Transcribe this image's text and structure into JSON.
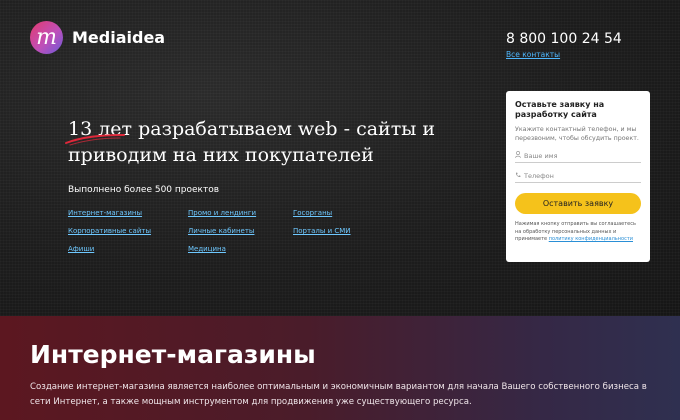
{
  "header": {
    "logo_letter": "m",
    "brand": "Mediaidea",
    "phone": "8 800 100 24 54",
    "contacts_link": "Все контакты"
  },
  "hero": {
    "headline_accent": "13 лет",
    "headline_rest_line1": " разрабатываем web - сайты и",
    "headline_line2": "приводим на них покупателей",
    "projects_count": "Выполнено более 500 проектов",
    "categories": [
      "Интернет-магазины",
      "Промо и лендинги",
      "Госорганы",
      "Корпоративные сайты",
      "Личные кабинеты",
      "Порталы и СМИ",
      "Афиши",
      "Медицина"
    ]
  },
  "form": {
    "title": "Оставьте заявку на разработку сайта",
    "description": "Укажите контактный телефон, и мы перезвоним, чтобы обсудить проект.",
    "name_placeholder": "Ваше имя",
    "phone_placeholder": "Телефон",
    "submit_label": "Оставить заявку",
    "legal_text": "Нажимая кнопку отправить вы соглашаетесь на обработку персональных данных и принимаете",
    "legal_link": "политику конфиденциальности",
    "icons": [
      "user-icon",
      "phone-icon"
    ]
  },
  "section": {
    "title": "Интернет-магазины",
    "text": "Создание интернет-магазина является наиболее оптимальным и экономичным вариантом для начала Вашего собственного бизнеса в сети Интернет, а также мощным инструментом для продвижения уже существующего ресурса."
  },
  "colors": {
    "accent_link": "#4fb8ff",
    "button": "#f5c21b",
    "underline_stroke": "#e0283a"
  }
}
